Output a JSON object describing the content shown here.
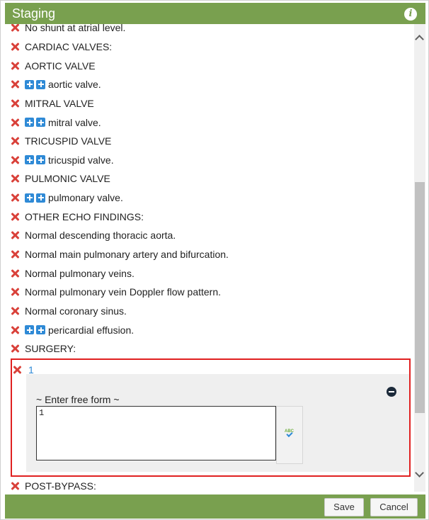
{
  "dialog": {
    "title": "Staging",
    "info_icon": "info-icon"
  },
  "rows": [
    {
      "text": "No shunt at atrial level.",
      "plus": false
    },
    {
      "text": "CARDIAC VALVES:",
      "plus": false
    },
    {
      "text": "AORTIC VALVE",
      "plus": false
    },
    {
      "text": "aortic valve.",
      "plus": true
    },
    {
      "text": "MITRAL VALVE",
      "plus": false
    },
    {
      "text": "mitral valve.",
      "plus": true
    },
    {
      "text": "TRICUSPID VALVE",
      "plus": false
    },
    {
      "text": "tricuspid valve.",
      "plus": true
    },
    {
      "text": "PULMONIC VALVE",
      "plus": false
    },
    {
      "text": "pulmonary valve.",
      "plus": true
    },
    {
      "text": "OTHER ECHO FINDINGS:",
      "plus": false
    },
    {
      "text": "Normal descending thoracic aorta.",
      "plus": false
    },
    {
      "text": "Normal main pulmonary artery and bifurcation.",
      "plus": false
    },
    {
      "text": "Normal pulmonary veins.",
      "plus": false
    },
    {
      "text": "Normal pulmonary vein Doppler flow pattern.",
      "plus": false
    },
    {
      "text": "Normal coronary sinus.",
      "plus": false
    },
    {
      "text": "pericardial effusion.",
      "plus": true
    },
    {
      "text": "SURGERY:",
      "plus": false
    }
  ],
  "selected_item": {
    "value": "1",
    "free_form_label": "~ Enter free form ~",
    "input_value": "1",
    "spellcheck_icon_text": "ABC"
  },
  "post_row": {
    "text": "POST-BYPASS:"
  },
  "footer": {
    "save_label": "Save",
    "cancel_label": "Cancel"
  },
  "colors": {
    "header_green": "#79a04f",
    "remove_red": "#d9413a",
    "add_blue": "#2f8ad6",
    "selection_border": "#e02020"
  }
}
